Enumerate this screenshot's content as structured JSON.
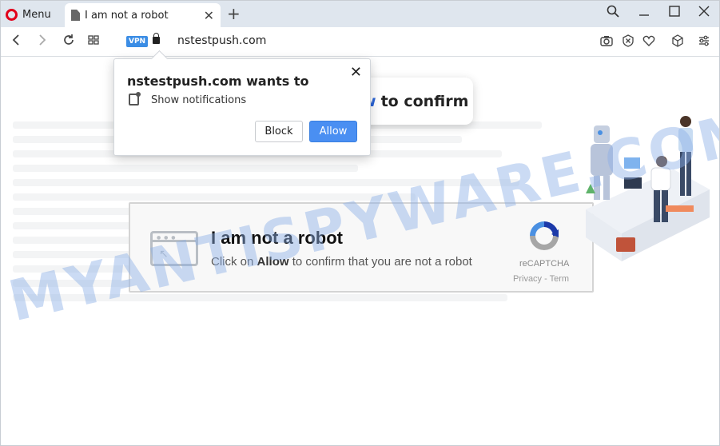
{
  "browser": {
    "menu_label": "Menu",
    "tab_title": "I am not a robot",
    "vpn_badge": "VPN",
    "url": "nstestpush.com"
  },
  "icons": {
    "menu": "opera-logo-icon",
    "tab": "document-icon",
    "tab_close": "close-icon",
    "new_tab": "plus-icon",
    "search": "search-icon",
    "minimize": "minimize-icon",
    "maximize": "maximize-icon",
    "close": "close-icon",
    "back": "back-icon",
    "forward": "forward-icon",
    "reload": "reload-icon",
    "speed_dial": "grid-icon",
    "lock": "lock-icon",
    "snapshot": "camera-icon",
    "adblock": "shield-x-icon",
    "favorite": "heart-icon",
    "extensions": "cube-icon",
    "easy_setup": "sliders-icon",
    "notification": "notification-icon"
  },
  "permission_popup": {
    "title": "nstestpush.com wants to",
    "permission": "Show notifications",
    "block_label": "Block",
    "allow_label": "Allow",
    "close_glyph": "✕"
  },
  "page": {
    "bubble_highlight": "w",
    "bubble_text": "to confirm",
    "captcha_title": "I am not a robot",
    "captcha_sub_prefix": "Click on ",
    "captcha_sub_bold": "Allow",
    "captcha_sub_suffix": " to confirm that you are not a robot",
    "recaptcha_label": "reCAPTCHA",
    "recaptcha_links": "Privacy - Term"
  },
  "watermark": "MYANTISPYWARE.COM",
  "colors": {
    "accent": "#4a8ff2",
    "opera_red": "#e2001a",
    "tab_bar": "#dfe6ee",
    "watermark": "#8cafe6"
  }
}
